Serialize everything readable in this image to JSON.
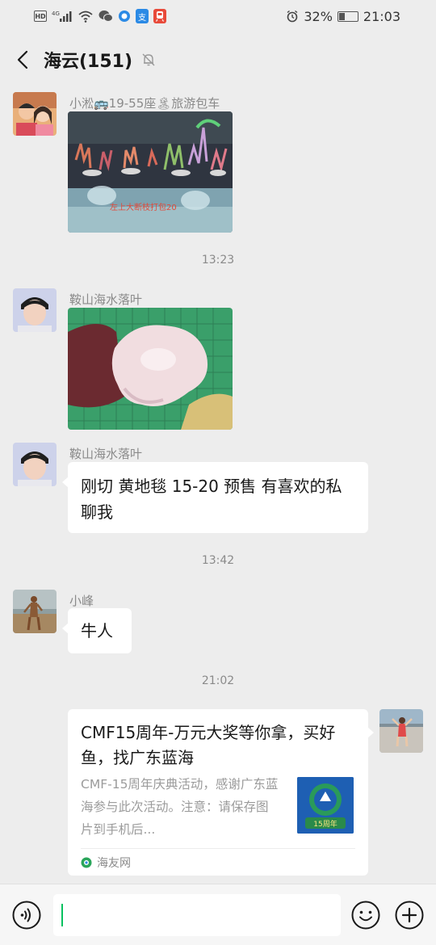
{
  "status_bar": {
    "left_icons": [
      "hd-icon",
      "signal-4g-icon",
      "wifi-icon",
      "wechat-icon",
      "browser-icon",
      "alipay-icon",
      "train-icon"
    ],
    "hd": "HD",
    "net": "4G",
    "alipay_char": "支",
    "battery": "32%",
    "time": "21:03",
    "battery_level": 0.32
  },
  "header": {
    "title": "海云(151)",
    "back_icon": "chevron-left-icon",
    "mute_icon": "bell-muted-icon"
  },
  "messages": [
    {
      "type": "image",
      "sender": "小淞🚌19-55座🏝旅游包车",
      "image_desc": "coral-tank",
      "overlay_text": "左上大断枝打包20"
    },
    {
      "type": "timestamp",
      "text": "13:23"
    },
    {
      "type": "image",
      "sender": "鞍山海水落叶",
      "image_desc": "mushroom-coral"
    },
    {
      "type": "text",
      "sender": "鞍山海水落叶",
      "text": "刚切 黄地毯 15-20 预售 有喜欢的私聊我"
    },
    {
      "type": "timestamp",
      "text": "13:42"
    },
    {
      "type": "text",
      "sender": "小峰",
      "text": "牛人"
    },
    {
      "type": "timestamp",
      "text": "21:02"
    },
    {
      "type": "link",
      "title": "CMF15周年-万元大奖等你拿，买好鱼，找广东蓝海",
      "description": "CMF-15周年庆典活动，感谢广东蓝海参与此次活动。注意：请保存图片到手机后...",
      "thumb_text": "15周年",
      "source": "海友网"
    }
  ],
  "input_bar": {
    "voice_icon": "voice-icon",
    "emoji_icon": "emoji-icon",
    "plus_icon": "plus-icon",
    "value": ""
  },
  "colors": {
    "background": "#ededed",
    "bubble": "#ffffff",
    "accent": "#07c160"
  }
}
